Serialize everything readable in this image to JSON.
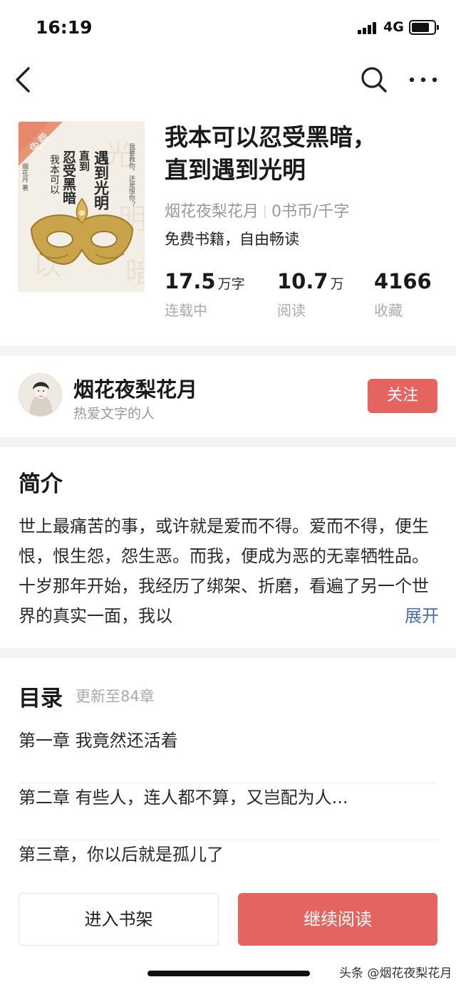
{
  "status_bar": {
    "time": "16:19",
    "network": "4G",
    "battery_level": 0.8
  },
  "nav": {
    "back_icon": "chevron-left-icon",
    "search_icon": "search-icon",
    "more_icon": "more-icon"
  },
  "book": {
    "cover_badge": "免费",
    "cover_title_lines": [
      "遇到光明",
      "直到",
      "忍受黑暗",
      "我本可以"
    ],
    "cover_author": "烟花月 著",
    "cover_tagline": "我要救你，还是恨你？",
    "title_line1": "我本可以忍受黑暗，",
    "title_line2": "直到遇到光明",
    "author": "烟花夜梨花月",
    "price": "0书币/千字",
    "free_text": "免费书籍，自由畅读",
    "stats": [
      {
        "value": "17.5",
        "unit": "万字",
        "label": "连载中"
      },
      {
        "value": "10.7",
        "unit": "万",
        "label": "阅读"
      },
      {
        "value": "4166",
        "unit": "",
        "label": "收藏"
      }
    ]
  },
  "author_card": {
    "name": "烟花夜梨花月",
    "bio": "热爱文字的人",
    "follow_label": "关注"
  },
  "intro": {
    "heading": "简介",
    "text": "世上最痛苦的事，或许就是爱而不得。爱而不得，便生恨，恨生怨，怨生恶。而我，便成为恶的无辜牺牲品。十岁那年开始，我经历了绑架、折磨，看遍了另一个世界的真实一面，我以",
    "expand_label": "展开"
  },
  "toc": {
    "heading": "目录",
    "update_text": "更新至84章",
    "chapters": [
      "第一章 我竟然还活着",
      "第二章 有些人，连人都不算，又岂配为人...",
      "第三章，你以后就是孤儿了"
    ]
  },
  "bottom": {
    "shelf_label": "进入书架",
    "read_label": "继续阅读"
  },
  "watermark": "头条 @烟花夜梨花月",
  "colors": {
    "accent": "#e46560",
    "link": "#4a6fa5",
    "muted": "#999999"
  }
}
